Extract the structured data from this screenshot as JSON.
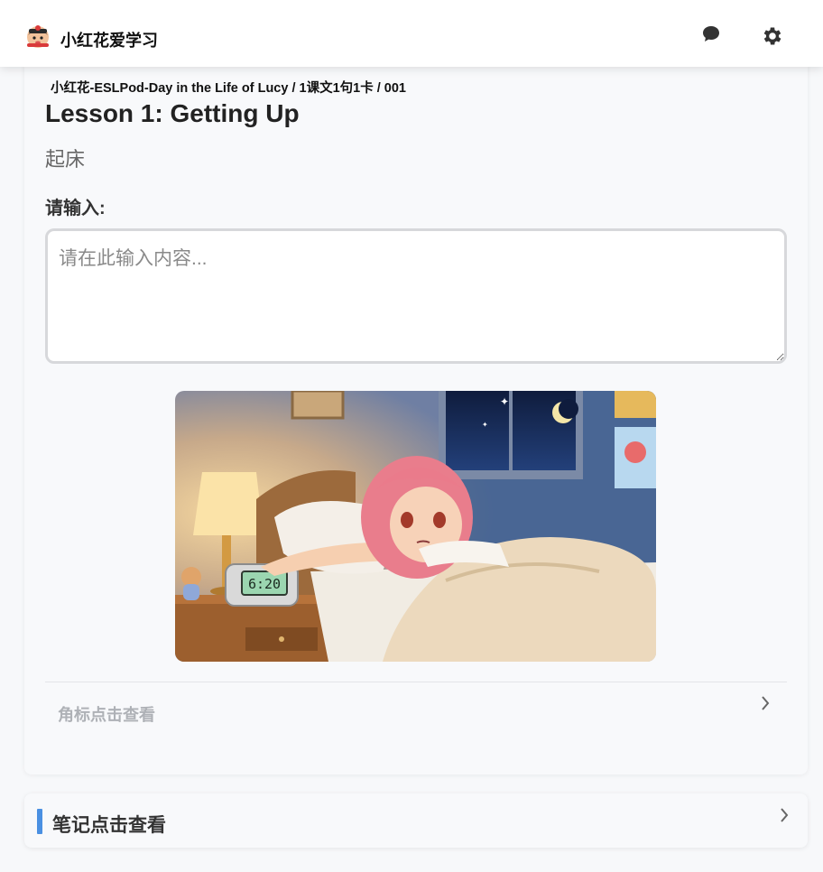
{
  "header": {
    "app_title": "小红花爱学习",
    "logo_icon": "cartoon-girl-avatar-icon",
    "chat_icon": "chat-bubble-icon",
    "settings_icon": "gear-icon"
  },
  "lesson": {
    "breadcrumb": "小红花-ESLPod-Day in the Life of Lucy / 1课文1句1卡 / 001",
    "title": "Lesson 1: Getting Up",
    "subtitle": "起床",
    "input_label": "请输入:",
    "input_placeholder": "请在此输入内容...",
    "input_value": "",
    "illustration_clock": "6:20",
    "illustration_icon": "girl-waking-up-illustration"
  },
  "corner_view": {
    "label": "角标点击查看",
    "chevron_icon": "chevron-right-icon"
  },
  "notes": {
    "label": "笔记点击查看",
    "chevron_icon": "chevron-right-icon",
    "accent_color": "#4a90e2"
  }
}
